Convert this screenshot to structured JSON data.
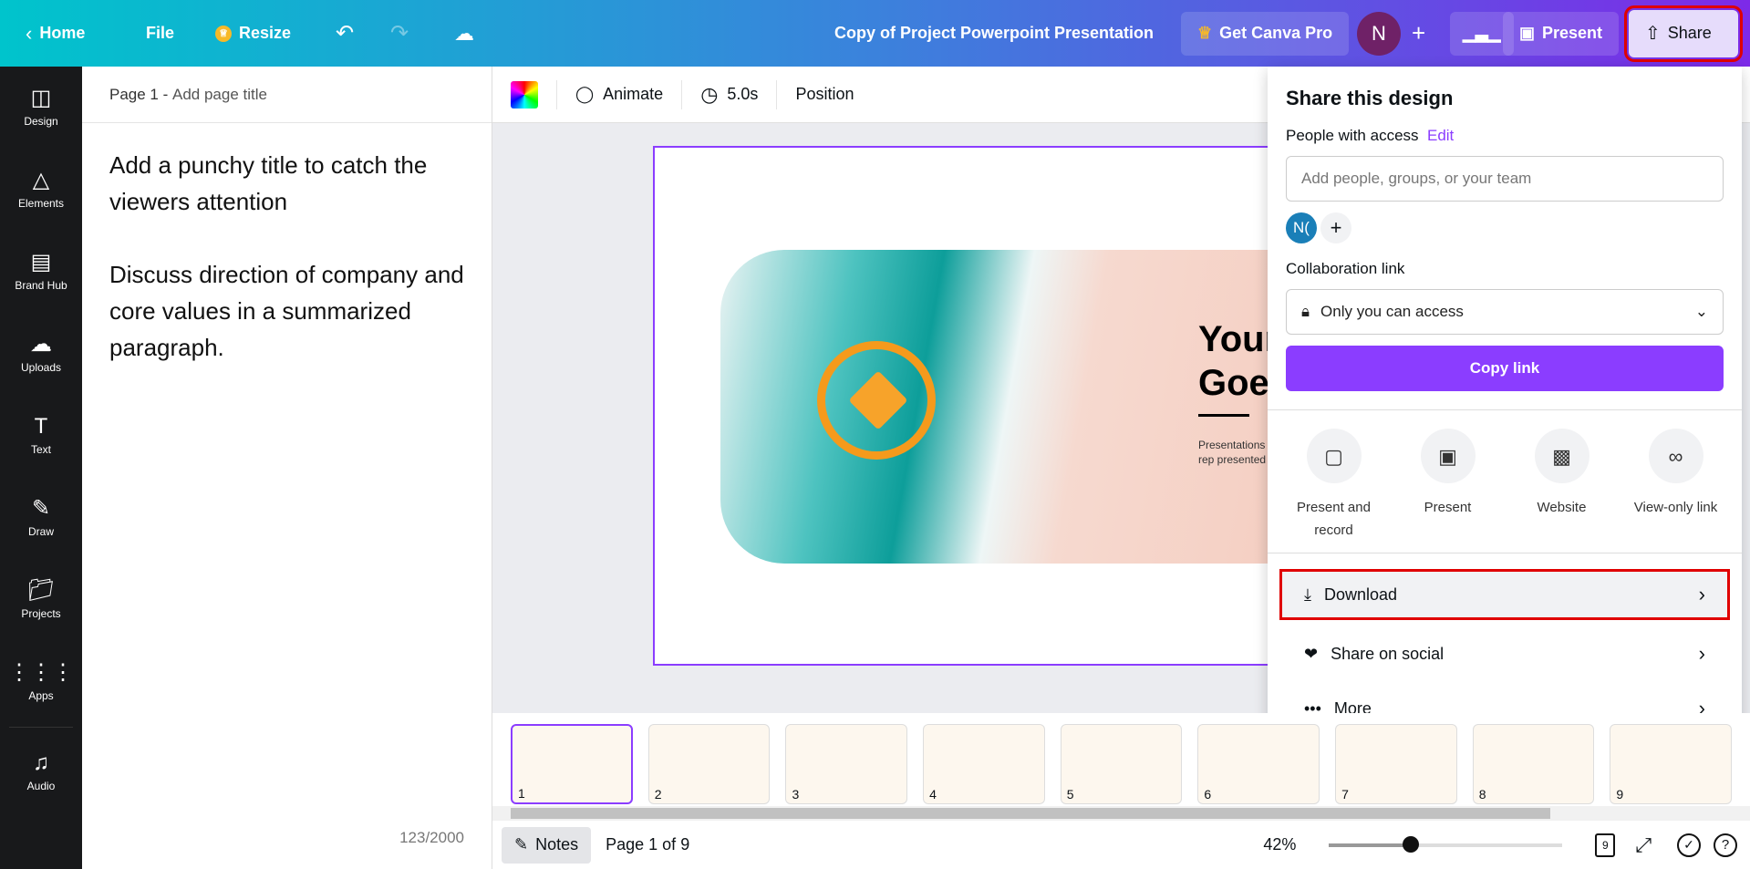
{
  "topbar": {
    "home": "Home",
    "file": "File",
    "resize": "Resize",
    "title": "Copy of Project Powerpoint Presentation",
    "get_pro": "Get Canva Pro",
    "avatar": "N",
    "present": "Present",
    "share": "Share"
  },
  "sidebar": [
    {
      "label": "Design",
      "icon": "layout-icon"
    },
    {
      "label": "Elements",
      "icon": "shapes-icon"
    },
    {
      "label": "Brand Hub",
      "icon": "brand-icon"
    },
    {
      "label": "Uploads",
      "icon": "cloud-upload-icon"
    },
    {
      "label": "Text",
      "icon": "text-icon"
    },
    {
      "label": "Draw",
      "icon": "draw-icon"
    },
    {
      "label": "Projects",
      "icon": "folder-icon"
    },
    {
      "label": "Apps",
      "icon": "apps-icon"
    },
    {
      "label": "Audio",
      "icon": "music-icon"
    }
  ],
  "notes": {
    "page": "Page 1 - ",
    "page_title_placeholder": "Add page title",
    "text": "Add a punchy title to catch the viewers attention\n\nDiscuss direction of company and core values in a summarized paragraph.",
    "count": "123/2000"
  },
  "toolbar": {
    "animate": "Animate",
    "duration": "5.0s",
    "position": "Position"
  },
  "slide": {
    "title": "Your\nGoes",
    "text": "Presentations can be used as speeches, rep presented bef"
  },
  "share": {
    "title": "Share this design",
    "people_label": "People with access",
    "edit": "Edit",
    "input_placeholder": "Add people, groups, or your team",
    "avatar": "N(",
    "collab_label": "Collaboration link",
    "access": "Only you can access",
    "copy": "Copy link",
    "options": [
      "Present and record",
      "Present",
      "Website",
      "View-only link"
    ],
    "rows": [
      "Download",
      "Share on social",
      "More"
    ]
  },
  "thumbnails": [
    "1",
    "2",
    "3",
    "4",
    "5",
    "6",
    "7",
    "8",
    "9"
  ],
  "bottom": {
    "notes": "Notes",
    "page": "Page 1 of 9",
    "zoom": "42%",
    "zoom_value": 42,
    "pages_badge": "9"
  },
  "colors": {
    "accent": "#8b3dff",
    "highlight": "#e00000"
  }
}
